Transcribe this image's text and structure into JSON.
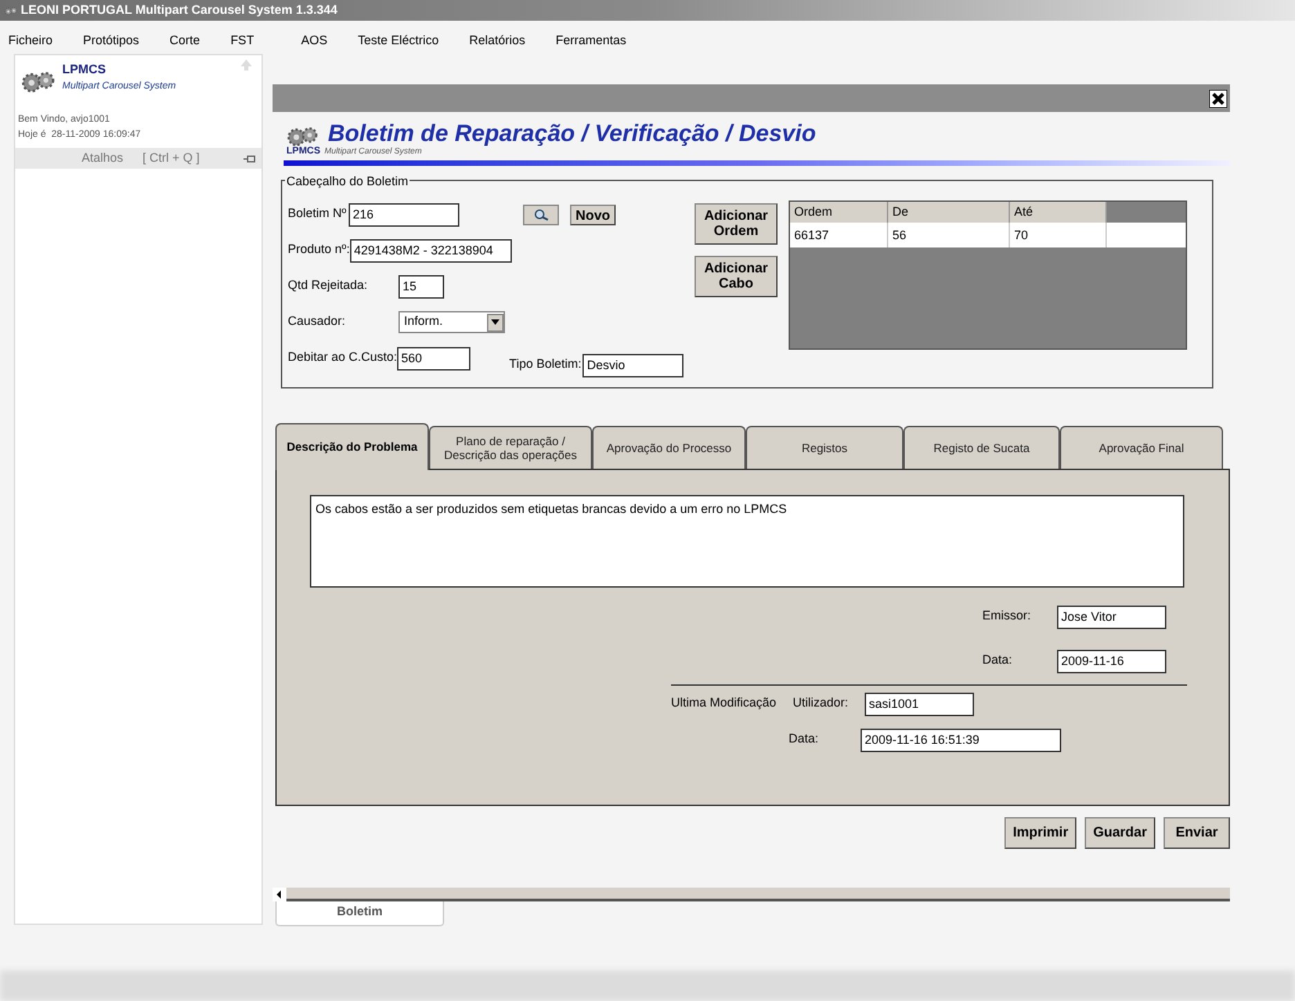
{
  "window": {
    "title": "LEONI PORTUGAL Multipart Carousel System 1.3.344"
  },
  "menu": [
    "Ficheiro",
    "Protótipos",
    "Corte",
    "FST",
    "AOS",
    "Teste Eléctrico",
    "Relatórios",
    "Ferramentas"
  ],
  "sidebar": {
    "logo_title": "LPMCS",
    "logo_subtitle": "Multipart Carousel System",
    "welcome": "Bem Vindo, avjo1001",
    "today": "Hoje é  28-11-2009 16:09:47",
    "shortcuts_label": "Atalhos",
    "shortcuts_key": "[ Ctrl + Q ]"
  },
  "form": {
    "title": "Boletim de Reparação / Verificação / Desvio",
    "logo_title": "LPMCS",
    "logo_subtitle": "Multipart Carousel System",
    "group_title": "Cabeçalho do Boletim",
    "boletim_label": "Boletim Nº",
    "boletim_value": "216",
    "new_button": "Novo",
    "produto_label": "Produto nº:",
    "produto_value": "4291438M2 - 322138904",
    "qtd_label": "Qtd Rejeitada:",
    "qtd_value": "15",
    "causador_label": "Causador:",
    "causador_value": "Inform.",
    "debitar_label": "Debitar ao C.Custo:",
    "debitar_value": "560",
    "tipo_label": "Tipo Boletim:",
    "tipo_value": "Desvio",
    "add_order_button": "Adicionar Ordem",
    "add_cable_button": "Adicionar Cabo",
    "table": {
      "columns": [
        "Ordem",
        "De",
        "Até"
      ],
      "rows": [
        [
          "66137",
          "56",
          "70"
        ]
      ]
    }
  },
  "tabs": [
    {
      "label": "Descrição do Problema",
      "selected": true
    },
    {
      "label": "Plano de reparação / Descrição das operações",
      "selected": false
    },
    {
      "label": "Aprovação do Processo",
      "selected": false
    },
    {
      "label": "Registos",
      "selected": false
    },
    {
      "label": "Registo de  Sucata",
      "selected": false
    },
    {
      "label": "Aprovação Final",
      "selected": false
    }
  ],
  "problem": {
    "description": "Os cabos estão a ser produzidos sem etiquetas brancas devido a um erro no LPMCS",
    "emissor_label": "Emissor:",
    "emissor_value": "Jose Vitor",
    "data_label": "Data:",
    "data_value": "2009-11-16",
    "last_mod_label": "Ultima Modificação",
    "user_label": "Utilizador:",
    "user_value": "sasi1001",
    "mod_data_label": "Data:",
    "mod_data_value": "2009-11-16 16:51:39"
  },
  "buttons": [
    "Imprimir",
    "Guardar",
    "Enviar"
  ],
  "document_tabs": [
    {
      "label": "Boletim",
      "selected": true
    }
  ]
}
